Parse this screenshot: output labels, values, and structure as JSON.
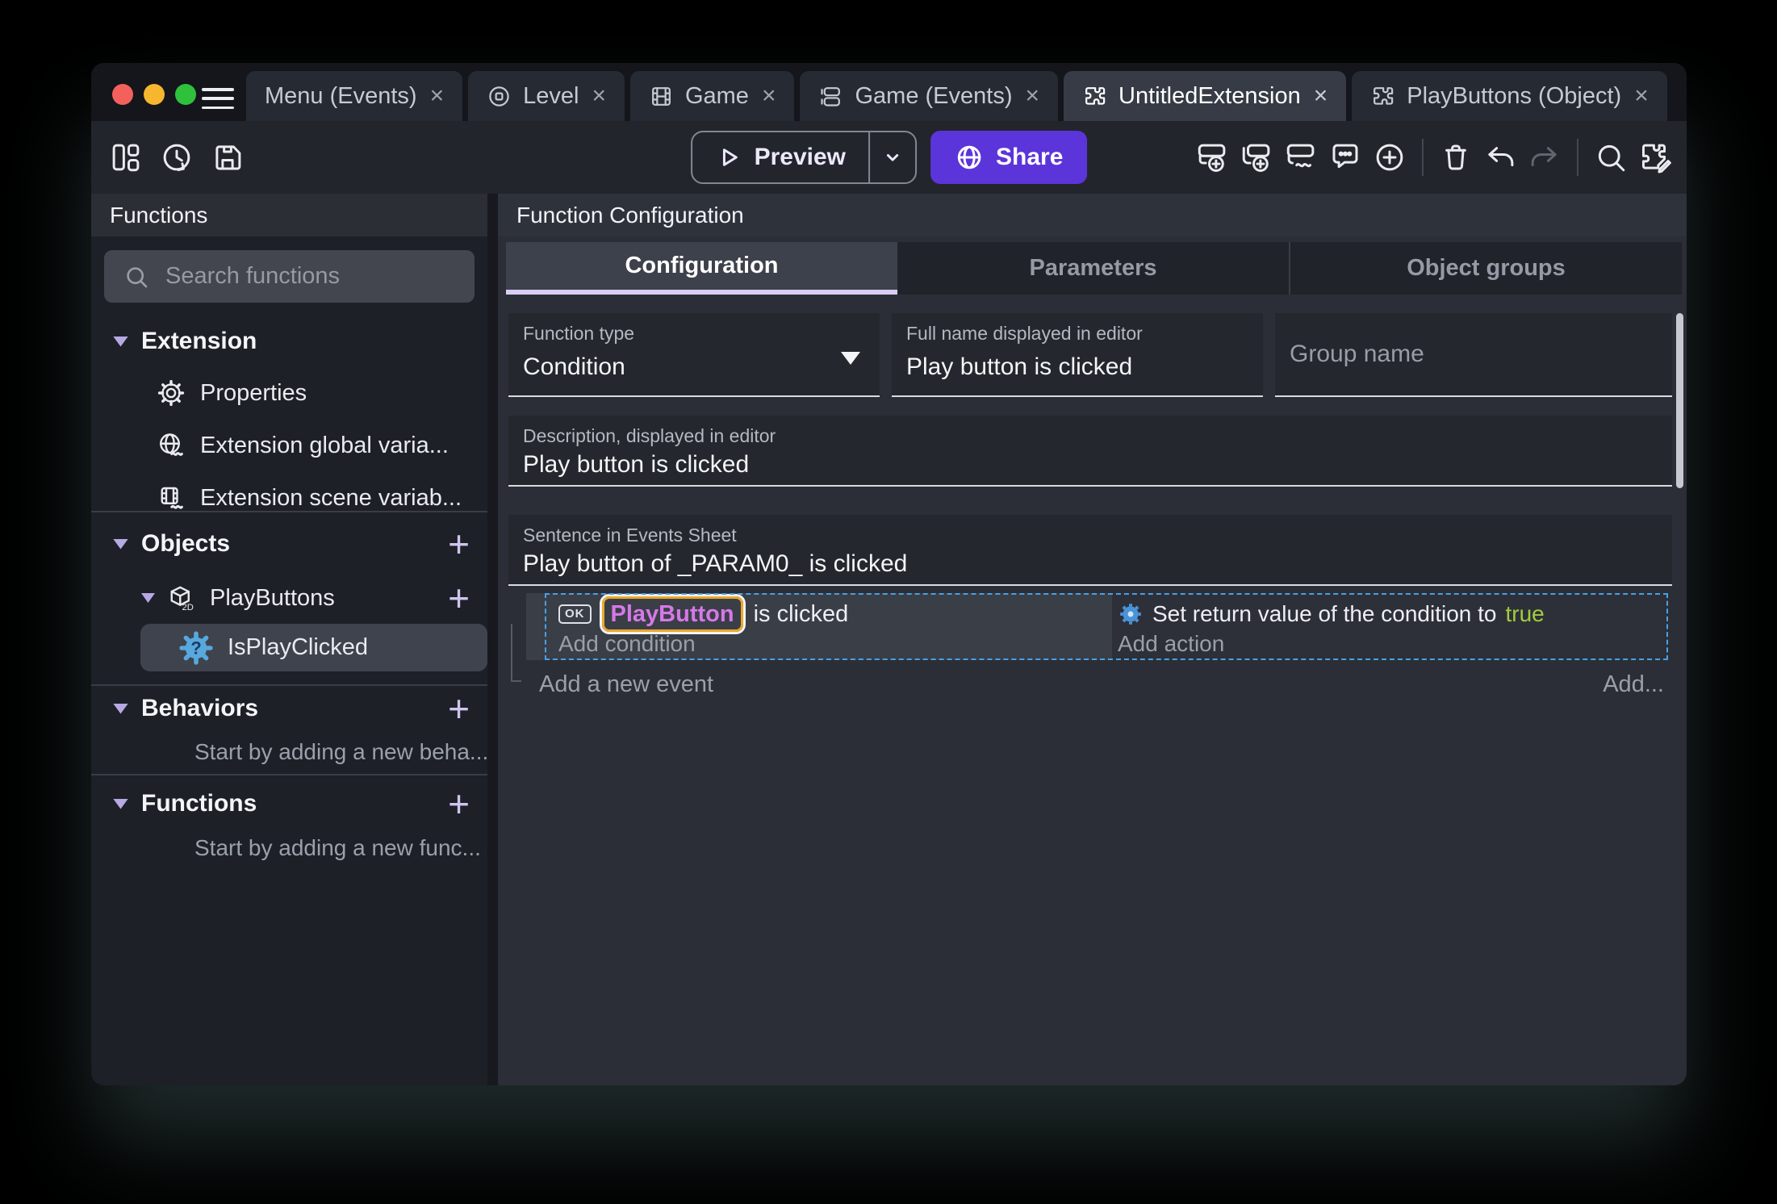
{
  "tabbar": {
    "close_glyph": "×",
    "tabs": [
      {
        "label": "Menu (Events)"
      },
      {
        "label": "Level"
      },
      {
        "label": "Game"
      },
      {
        "label": "Game (Events)"
      },
      {
        "label": "UntitledExtension"
      },
      {
        "label": "PlayButtons (Object)"
      }
    ]
  },
  "toolbar": {
    "preview_label": "Preview",
    "share_label": "Share"
  },
  "sidebar": {
    "title": "Functions",
    "search_placeholder": "Search functions",
    "extension_section": "Extension",
    "items": {
      "properties": "Properties",
      "global_vars": "Extension global varia...",
      "scene_vars": "Extension scene variab..."
    },
    "objects_section": "Objects",
    "object_name": "PlayButtons",
    "function_name": "IsPlayClicked",
    "behaviors_section": "Behaviors",
    "behaviors_empty": "Start by adding a new beha...",
    "functions_section": "Functions",
    "functions_empty": "Start by adding a new func..."
  },
  "main": {
    "title": "Function Configuration",
    "tabs": [
      {
        "label": "Configuration"
      },
      {
        "label": "Parameters"
      },
      {
        "label": "Object groups"
      }
    ],
    "function_type_label": "Function type",
    "function_type_value": "Condition",
    "full_name_label": "Full name displayed in editor",
    "full_name_value": "Play button is clicked",
    "group_name_placeholder": "Group name",
    "description_label": "Description, displayed in editor",
    "description_value": "Play button is clicked",
    "sentence_label": "Sentence in Events Sheet",
    "sentence_value": "Play button of _PARAM0_ is clicked"
  },
  "events": {
    "condition_icon_label": "OK",
    "condition_object": "PlayButton",
    "condition_text": "is clicked",
    "add_condition": "Add condition",
    "action_text": "Set return value of the condition to",
    "action_value": "true",
    "add_action": "Add action",
    "add_new_event": "Add a new event",
    "add_more": "Add..."
  },
  "colors": {
    "accent_purple": "#5b35d9",
    "selection_blue": "#4aa0e4",
    "object_border_orange": "#eda72d",
    "object_text_pink": "#d678e8",
    "true_green": "#a3cc3e",
    "tab_underline_lavender": "#d9cdf8"
  }
}
